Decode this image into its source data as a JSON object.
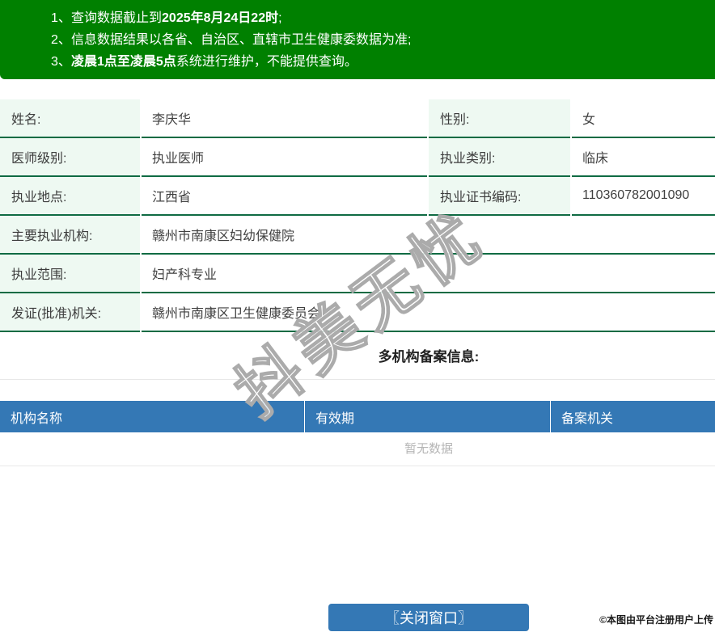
{
  "notices": {
    "item1": {
      "num": "1、",
      "t1": "查询数据截止到",
      "t2": "2025年8月24日22时",
      "t3": ";"
    },
    "item2": {
      "num": "2、",
      "t1": "信息数据结果以各省、自治区、直辖市卫生健康委数据为准;"
    },
    "item3": {
      "num": "3、",
      "t2": "凌晨1点至凌晨5点",
      "t3": "系统进行维护，不能提供查询。"
    }
  },
  "info": {
    "row1": {
      "l1": "姓名:",
      "v1": "李庆华",
      "l2": "性别:",
      "v2": "女"
    },
    "row2": {
      "l1": "医师级别:",
      "v1": "执业医师",
      "l2": "执业类别:",
      "v2": "临床"
    },
    "row3": {
      "l1": "执业地点:",
      "v1": "江西省",
      "l2": "执业证书编码:",
      "v2": "110360782001090"
    },
    "row4": {
      "l1": "主要执业机构:",
      "v1": "赣州市南康区妇幼保健院"
    },
    "row5": {
      "l1": "执业范围:",
      "v1": "妇产科专业"
    },
    "row6": {
      "l1": "发证(批准)机关:",
      "v1": "赣州市南康区卫生健康委员会"
    }
  },
  "filing": {
    "title": "多机构备案信息:",
    "columns": [
      "机构名称",
      "有效期",
      "备案机关"
    ],
    "empty": "暂无数据"
  },
  "button": {
    "close": "〖关闭窗口〗"
  },
  "watermark": {
    "text": "抖美无忧"
  },
  "credit": {
    "text": "©本图由平台注册用户上传"
  },
  "colors": {
    "banner_green": "#008000",
    "row_border_green": "#0f6b43",
    "label_bg": "#eef9f2",
    "table_header_blue": "#3478b5",
    "button_blue": "#3478b5",
    "empty_text": "#b5b5b5"
  }
}
